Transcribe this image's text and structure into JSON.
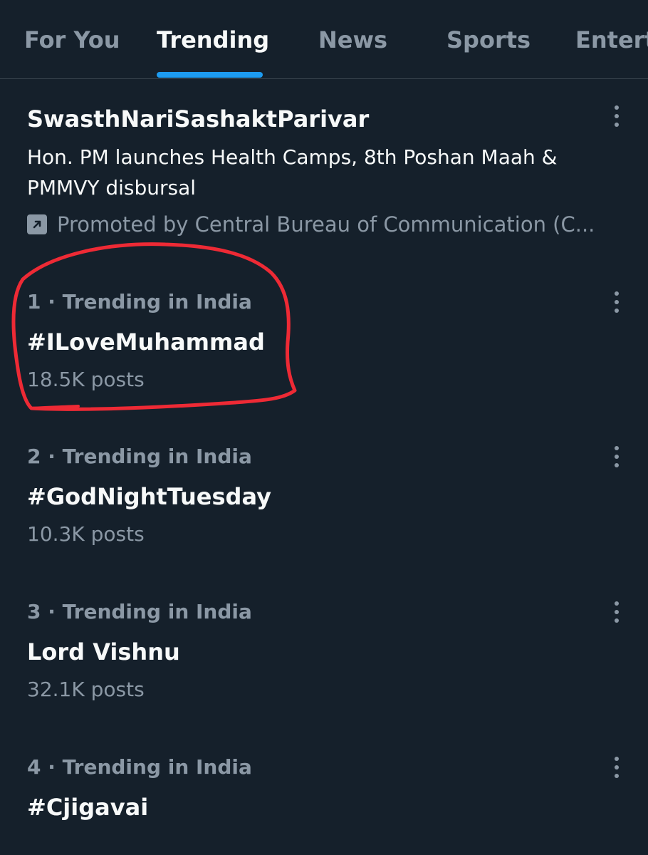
{
  "tabs": [
    {
      "label": "For You",
      "active": false
    },
    {
      "label": "Trending",
      "active": true
    },
    {
      "label": "News",
      "active": false
    },
    {
      "label": "Sports",
      "active": false
    },
    {
      "label": "Entert",
      "active": false
    }
  ],
  "promoted": {
    "title": "SwasthNariSashaktParivar",
    "description": "Hon. PM launches Health Camps, 8th Poshan Maah & PMMVY disbursal",
    "promoted_by": "Promoted by Central Bureau of Communication (C..."
  },
  "trends": [
    {
      "context": "1 · Trending in India",
      "name": "#ILoveMuhammad",
      "posts": "18.5K posts",
      "circled": true
    },
    {
      "context": "2 · Trending in India",
      "name": "#GodNightTuesday",
      "posts": "10.3K posts"
    },
    {
      "context": "3 · Trending in India",
      "name": "Lord Vishnu",
      "posts": "32.1K posts"
    },
    {
      "context": "4 · Trending in India",
      "name": "#Cjigavai",
      "posts": ""
    }
  ],
  "colors": {
    "background": "#15202b",
    "accent": "#1d9bf0",
    "annotation": "#ee2a35"
  }
}
